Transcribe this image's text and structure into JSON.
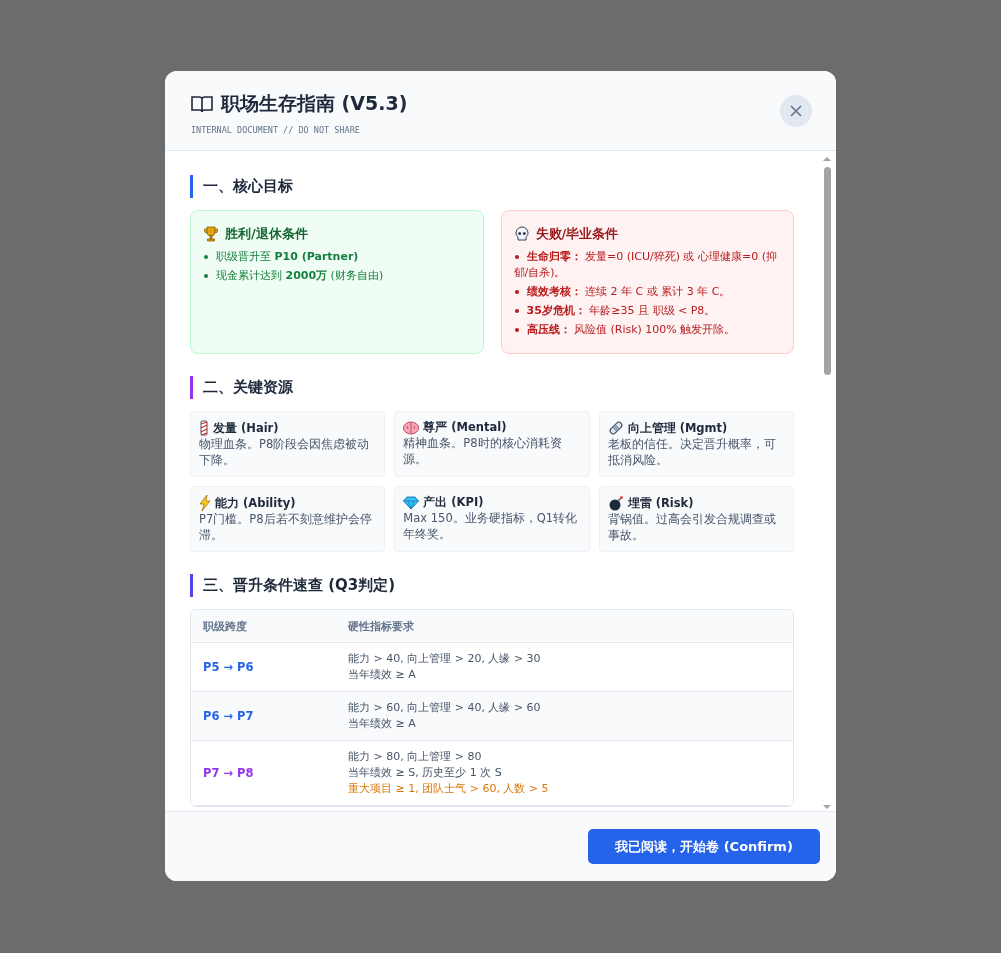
{
  "dialog": {
    "title": "职场生存指南 (V5.3)",
    "subtitle": "INTERNAL DOCUMENT // DO NOT SHARE"
  },
  "sections": [
    {
      "kind": "goals",
      "title": "一、核心目标",
      "color": "#2563eb",
      "cards": [
        {
          "kind": "win",
          "title": "胜利/退休条件",
          "items": [
            "职级晋升至 **P10 (Partner)**",
            "现金累计达到 **2000万** (财务自由)"
          ]
        },
        {
          "kind": "fail",
          "title": "失败/毕业条件",
          "items": [
            "**生命归零：** 发量=0 (ICU/猝死) 或 心理健康=0 (抑郁/自杀)。",
            "**绩效考核：** 连续 2 年 C 或 累计 3 年 C。",
            "**35岁危机：** 年龄≥35 且 职级 < P8。",
            "**高压线：** 风险值 (Risk) 100% 触发开除。"
          ]
        }
      ]
    },
    {
      "kind": "resources",
      "title": "二、关键资源",
      "color": "#9333ea",
      "cards": [
        {
          "name": "发量 (Hair)",
          "desc": "物理血条。P8阶段会因焦虑被动下降。"
        },
        {
          "name": "尊严 (Mental)",
          "desc": "精神血条。P8时的核心消耗资源。"
        },
        {
          "name": "向上管理 (Mgmt)",
          "desc": "老板的信任。决定晋升概率，可抵消风险。"
        },
        {
          "name": "能力 (Ability)",
          "desc": "P7门槛。P8后若不刻意维护会停滞。"
        },
        {
          "name": "产出 (KPI)",
          "desc": "Max 150。业务硬指标，Q1转化年终奖。"
        },
        {
          "name": "埋雷 (Risk)",
          "desc": "背锅值。过高会引发合规调查或事故。"
        }
      ]
    },
    {
      "kind": "table",
      "title": "三、晋升条件速查 (Q3判定)",
      "color": "#4f46e5",
      "columns": [
        "职级跨度",
        "硬性指标要求"
      ],
      "rows": [
        {
          "level": "P5 → P6",
          "color": "#2563eb",
          "lines": [
            {
              "kind": "normal",
              "text": "能力 > 40, 向上管理 > 20, 人缘 > 30"
            },
            {
              "kind": "normal",
              "text": "当年绩效 ≥ A"
            }
          ]
        },
        {
          "level": "P6 → P7",
          "color": "#2563eb",
          "lines": [
            {
              "kind": "normal",
              "text": "能力 > 60, 向上管理 > 40, 人缘 > 60"
            },
            {
              "kind": "normal",
              "text": "当年绩效 ≥ A"
            }
          ]
        },
        {
          "level": "P7 → P8",
          "color": "#9333ea",
          "lines": [
            {
              "kind": "normal",
              "text": "能力 > 80, 向上管理 > 80"
            },
            {
              "kind": "normal",
              "text": "当年绩效 ≥ S, 历史至少 1 次 S"
            },
            {
              "kind": "highlight",
              "text": "重大项目 ≥ 1, 团队士气 > 60, 人数 > 5"
            }
          ]
        }
      ]
    }
  ],
  "confirm_button": "我已阅读，开始卷 (Confirm)"
}
